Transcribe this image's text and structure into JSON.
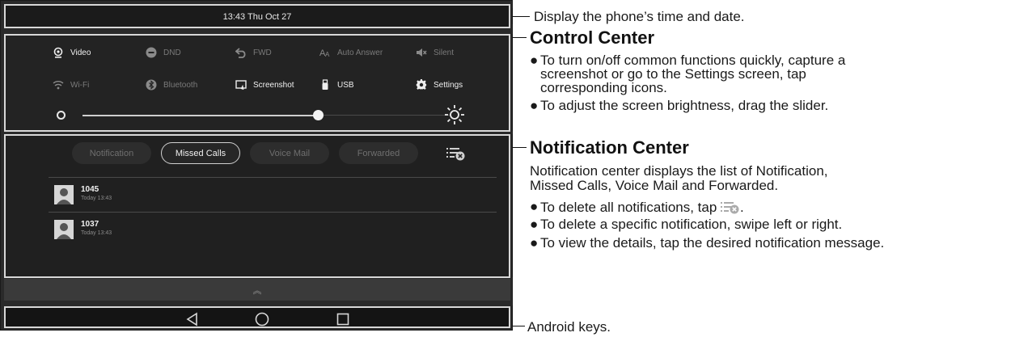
{
  "status_bar": {
    "datetime": "13:43 Thu Oct 27"
  },
  "control_center": {
    "row1": [
      {
        "label": "Video",
        "icon": "video-icon",
        "active": true
      },
      {
        "label": "DND",
        "icon": "dnd-icon",
        "active": false
      },
      {
        "label": "FWD",
        "icon": "forward-icon",
        "active": false
      },
      {
        "label": "Auto Answer",
        "icon": "auto-answer-icon",
        "active": false
      },
      {
        "label": "Silent",
        "icon": "silent-icon",
        "active": false
      }
    ],
    "row2": [
      {
        "label": "Wi-Fi",
        "icon": "wifi-icon",
        "active": false
      },
      {
        "label": "Bluetooth",
        "icon": "bluetooth-icon",
        "active": false
      },
      {
        "label": "Screenshot",
        "icon": "screenshot-icon",
        "active": true
      },
      {
        "label": "USB",
        "icon": "usb-icon",
        "active": true
      },
      {
        "label": "Settings",
        "icon": "settings-icon",
        "active": true
      }
    ],
    "brightness_level": 0.72
  },
  "notification_center": {
    "tabs": [
      {
        "label": "Notification",
        "active": false
      },
      {
        "label": "Missed Calls",
        "active": true
      },
      {
        "label": "Voice Mail",
        "active": false
      },
      {
        "label": "Forwarded",
        "active": false
      }
    ],
    "items": [
      {
        "name": "1045",
        "time": "Today 13:43"
      },
      {
        "name": "1037",
        "time": "Today 13:43"
      }
    ]
  },
  "nav_keys": [
    "back-icon",
    "home-icon",
    "recent-apps-icon"
  ],
  "callouts": {
    "status": "Display the phone’s time and date.",
    "control_heading": "Control Center",
    "control_b1_l1": "To turn on/off common functions quickly, capture a",
    "control_b1_l2": "screenshot or go to the Settings screen, tap",
    "control_b1_l3": "corresponding icons.",
    "control_b2": "To adjust the screen brightness, drag the slider.",
    "notif_heading": "Notification Center",
    "notif_desc_l1": "Notification center displays the list of Notification,",
    "notif_desc_l2": "Missed Calls, Voice Mail and Forwarded.",
    "notif_b1_pre": "To delete all notifications, tap",
    "notif_b1_post": ".",
    "notif_b2": "To delete a specific notification, swipe left or right.",
    "notif_b3": "To view the details, tap the desired notification message.",
    "android": "Android keys.",
    "bullet_symbol": "●"
  },
  "colors": {
    "screen_bg": "#232323",
    "active_text": "#f0f0f0",
    "inactive_text": "#7a7a7a"
  }
}
